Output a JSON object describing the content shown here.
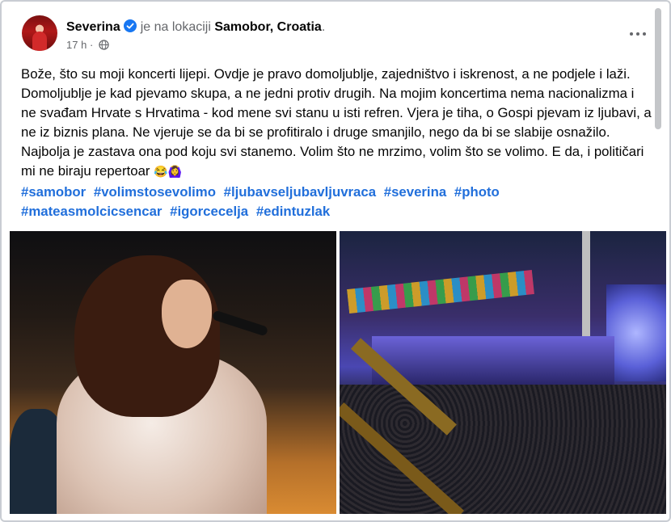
{
  "post": {
    "author": "Severina",
    "location_prefix": "je na lokaciji",
    "location": "Samobor, Croatia",
    "location_suffix": ".",
    "time": "17 h",
    "time_separator": "·",
    "body_text": "Bože, što su moji koncerti lijepi. Ovdje je pravo domoljublje, zajedništvo i iskrenost, a ne podjele i laži. Domoljublje je kad pjevamo skupa, a ne jedni protiv drugih. Na mojim koncertima nema nacionalizma i ne svađam Hrvate s Hrvatima - kod mene svi stanu u isti refren. Vjera je tiha, o Gospi pjevam iz ljubavi, a ne iz biznis plana. Ne vjeruje se da bi se profitiralo i druge smanjilo, nego da bi se slabije osnažilo. Najbolja je zastava ona pod koju svi stanemo. Volim što ne mrzimo, volim što se volimo. E da, i političari mi ne biraju repertoar",
    "emojis": "😂🙆‍♀️",
    "hashtags": [
      "#samobor",
      "#volimstosevolimo",
      "#ljubavseljubavljuvraca",
      "#severina",
      "#photo",
      "#mateasmolcicsencar",
      "#igorcecelja",
      "#edintuzlak"
    ]
  },
  "icons": {
    "verified": "verified-badge-icon",
    "audience": "globe-icon",
    "more": "more-options-icon"
  },
  "colors": {
    "link": "#216fdb",
    "verified": "#1877f2",
    "secondary_text": "#65676b"
  }
}
